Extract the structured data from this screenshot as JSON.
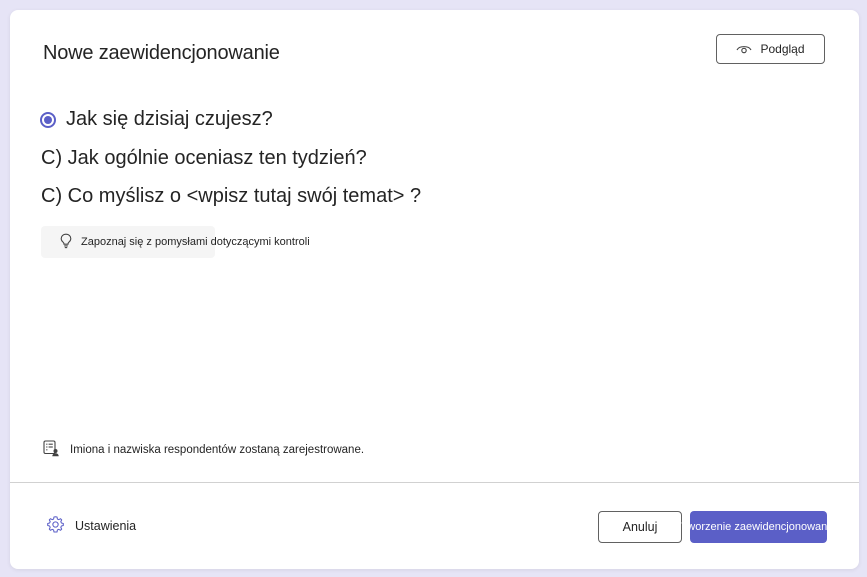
{
  "dialog": {
    "title": "Nowe zaewidencjonowanie",
    "preview_label": "Podgląd"
  },
  "questions": [
    {
      "text": "Jak się dzisiaj czujesz?",
      "selected": true
    },
    {
      "text": "C) Jak ogólnie oceniasz ten tydzień?"
    },
    {
      "text": "C) Co myślisz o <wpisz tutaj swój temat> ?"
    }
  ],
  "ideas_button": {
    "label": "Zapoznaj się z pomysłami dotyczącymi kontroli",
    "icon": "lightbulb-icon"
  },
  "notice": {
    "text": "Imiona i nazwiska respondentów zostaną zarejestrowane.",
    "icon": "recorded-names-icon"
  },
  "footer": {
    "settings_label": "Ustawienia",
    "cancel_label": "Anuluj",
    "create_label": "Tworzenie zaewidencjonowania"
  },
  "colors": {
    "accent": "#5b5fc7",
    "background": "#e6e4f6",
    "text": "#242424"
  }
}
